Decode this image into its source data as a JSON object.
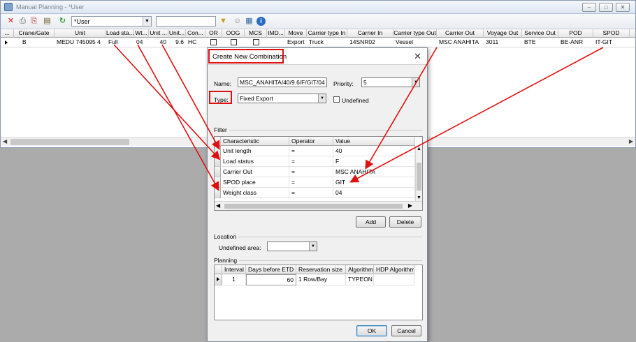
{
  "window": {
    "title": "Manual Planning - *User",
    "buttons": [
      "–",
      "□",
      "✕"
    ]
  },
  "toolbar": {
    "view_value": "*User",
    "icons": [
      "delete-icon",
      "print-icon",
      "print-preview-icon",
      "export-icon",
      "refresh-icon",
      "filter-icon",
      "user-icon",
      "lookup-icon",
      "info-icon"
    ]
  },
  "grid": {
    "columns": [
      "...",
      "Crane/Gate",
      "Unit",
      "Load sta...",
      "Wt...",
      "Unit ...",
      "Unit...",
      "Con...",
      "OR",
      "OOG",
      "MCS",
      "IMD...",
      "Move",
      "Carrier type In",
      "Carrier In",
      "Carrier type Out",
      "Carrier Out",
      "Voyage Out",
      "Service Out",
      "POD",
      "SPOD"
    ],
    "row": {
      "crane_gate": "B",
      "unit": "MEDU 745095 4",
      "load_status": "Full",
      "weight": "04",
      "unit_length": "40",
      "unit_height": "9.6",
      "container": "HC",
      "move": "Export",
      "carrier_type_in": "Truck",
      "carrier_in": "14SNR02",
      "carrier_type_out": "Vessel",
      "carrier_out": "MSC ANAHITA",
      "voyage_out": "3011",
      "service_out": "BTE",
      "pod": "BE-ANR",
      "spod": "IT-GIT"
    }
  },
  "dialog": {
    "title": "Create New Combination",
    "name_label": "Name:",
    "name_value": "MSC_ANAHITA/40/9.6/F/GIT/04",
    "priority_label": "Priority:",
    "priority_value": "5",
    "type_label": "Type:",
    "type_value": "Fixed Export",
    "undefined_label": "Undefined",
    "filter_label": "Filter",
    "filter_columns": [
      "Characteristic",
      "Operator",
      "Value"
    ],
    "filter_rows": [
      {
        "characteristic": "Unit length",
        "operator": "=",
        "value": "40"
      },
      {
        "characteristic": "Load status",
        "operator": "=",
        "value": "F"
      },
      {
        "characteristic": "Carrier Out",
        "operator": "=",
        "value": "MSC ANAHITA"
      },
      {
        "characteristic": "SPOD place",
        "operator": "=",
        "value": "GIT"
      },
      {
        "characteristic": "Weight class",
        "operator": "=",
        "value": "04"
      }
    ],
    "add_label": "Add",
    "delete_label": "Delete",
    "location_label": "Location",
    "undefined_area_label": "Undefined area:",
    "undefined_area_value": "",
    "planning_label": "Planning",
    "planning_columns": [
      "Interval",
      "Days before ETD",
      "Reservation size",
      "Algorithm",
      "HDP Algorithm"
    ],
    "planning_row": {
      "interval": "1",
      "days_before_etd": "60",
      "reservation_size": "1 Row/Bay",
      "algorithm": "TYPEON",
      "hdp_algorithm": ""
    },
    "ok_label": "OK",
    "cancel_label": "Cancel"
  },
  "colors": {
    "annotation": "#e01010",
    "selection": "#dce8f5"
  }
}
